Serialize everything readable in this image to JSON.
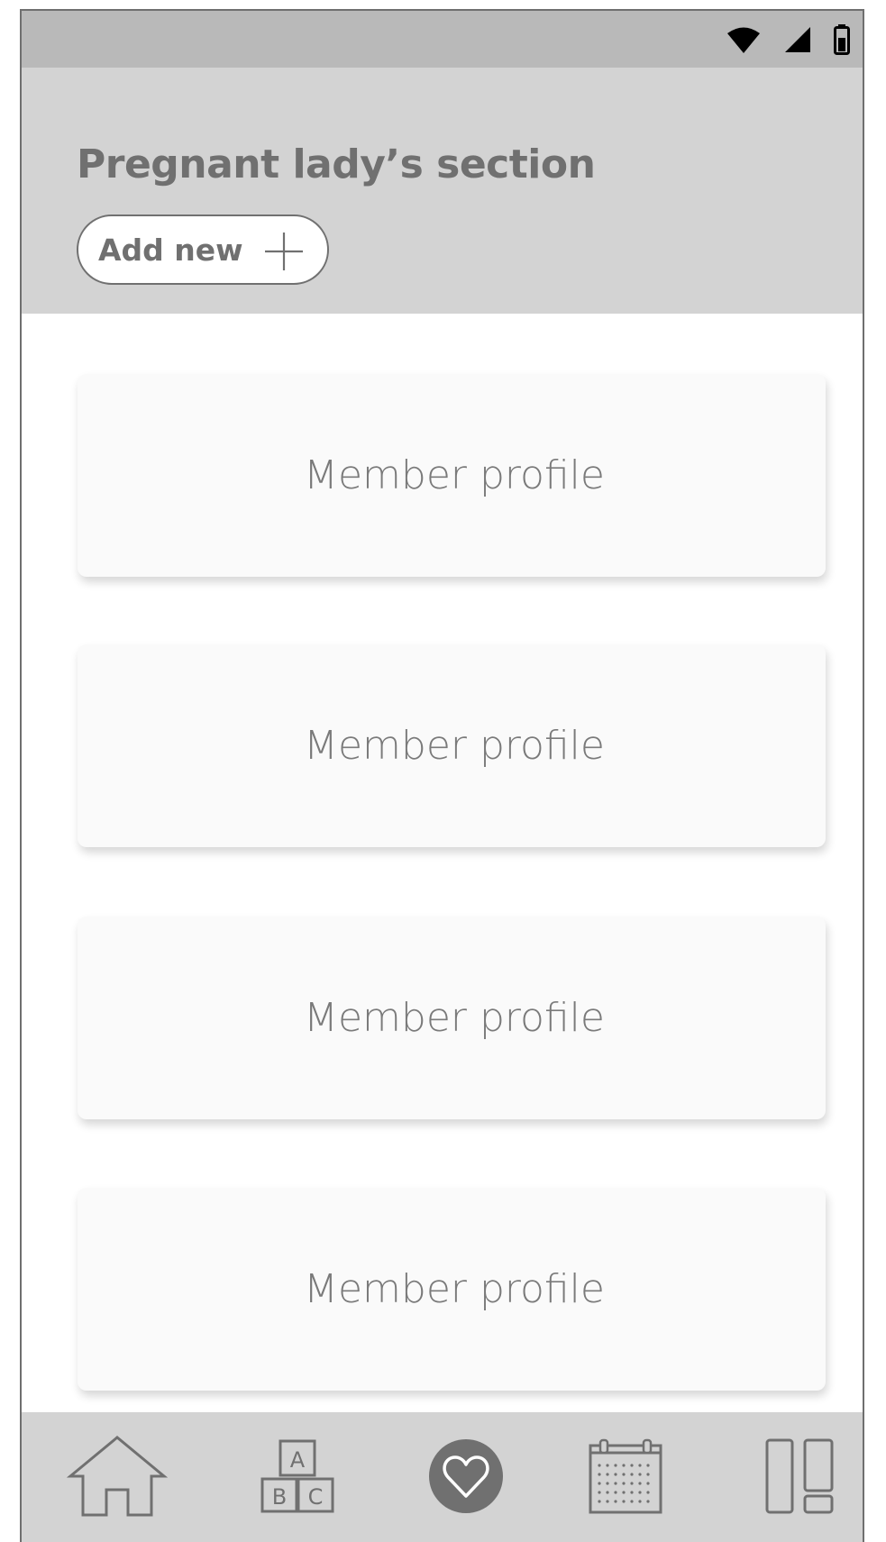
{
  "status_bar": {
    "icons": [
      "wifi-icon",
      "signal-icon",
      "battery-icon"
    ]
  },
  "header": {
    "title": "Pregnant lady’s section",
    "add_button": {
      "label": "Add new",
      "icon": "plus-icon"
    }
  },
  "profiles": [
    {
      "label": "Member profile"
    },
    {
      "label": "Member profile"
    },
    {
      "label": "Member profile"
    },
    {
      "label": "Member profile"
    }
  ],
  "bottom_nav": {
    "items": [
      {
        "icon": "home-icon",
        "active": false
      },
      {
        "icon": "abc-blocks-icon",
        "active": false,
        "block_letters": [
          "A",
          "B",
          "C"
        ]
      },
      {
        "icon": "heart-icon",
        "active": true
      },
      {
        "icon": "calendar-icon",
        "active": false
      },
      {
        "icon": "dashboard-icon",
        "active": false
      }
    ]
  },
  "colors": {
    "status_bar": "#b9b9b9",
    "header": "#d3d3d3",
    "text": "#707070",
    "card": "#fafafa",
    "active_nav": "#707070"
  }
}
